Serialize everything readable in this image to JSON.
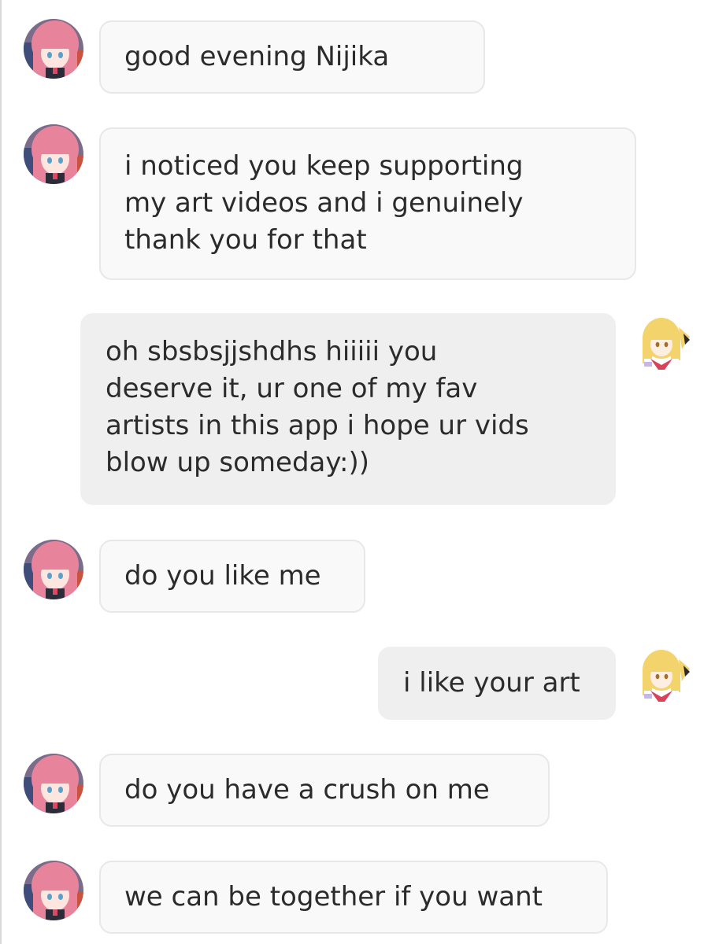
{
  "chat": {
    "contact_name": "Nijika",
    "messages": [
      {
        "sender": "other",
        "text": "good evening  Nijika"
      },
      {
        "sender": "other",
        "text": "i noticed you keep supporting\nmy art videos and i genuinely\nthank you for that"
      },
      {
        "sender": "self",
        "text": "oh sbsbsjjshdhs hiiiii you\ndeserve it, ur one of my fav\nartists in this app i hope ur vids\nblow up someday:))"
      },
      {
        "sender": "other",
        "text": "do you like me"
      },
      {
        "sender": "self",
        "text": "i like your art"
      },
      {
        "sender": "other",
        "text": "do you have a crush on me"
      },
      {
        "sender": "other",
        "text": "we can be together if you want"
      }
    ]
  },
  "avatars": {
    "other": {
      "icon": "pink-hair-avatar-icon",
      "hair_color": "#e7849c"
    },
    "self": {
      "icon": "blonde-hair-avatar-icon",
      "hair_color": "#f3d36b"
    }
  },
  "colors": {
    "incoming_bubble": "#f9f9f9",
    "outgoing_bubble": "#efefef",
    "text": "#2b2b2b"
  }
}
